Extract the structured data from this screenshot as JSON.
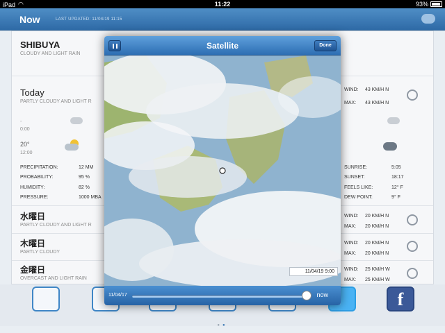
{
  "statusbar": {
    "device": "iPad",
    "time": "11:22",
    "battery": "93%"
  },
  "header": {
    "title": "Now",
    "updated": "LAST UPDATED: 11/04/19 11:15"
  },
  "location": {
    "name": "SHIBUYA",
    "condition": "CLOUDY AND LIGHT RAIN"
  },
  "today": {
    "title": "Today",
    "condition": "PARTLY CLOUDY AND LIGHT R",
    "left_temp_a": "-",
    "left_temp_b": "0:00",
    "left_temp_c": "20°",
    "left_time": "12:00",
    "rows_left": [
      {
        "label": "PRECIPITATION:",
        "value": "12 MM"
      },
      {
        "label": "PROBABILITY:",
        "value": "95 %"
      },
      {
        "label": "HUMIDITY:",
        "value": "82 %"
      },
      {
        "label": "PRESSURE:",
        "value": "1000 MBA"
      }
    ],
    "rows_right": [
      {
        "label": "SUNRISE:",
        "value": "5:05"
      },
      {
        "label": "SUNSET:",
        "value": "18:17"
      },
      {
        "label": "FEELS LIKE:",
        "value": "12° F"
      },
      {
        "label": "DEW POINT:",
        "value": "9° F"
      }
    ],
    "wind": {
      "label": "WIND:",
      "value": "43 KM/H N"
    },
    "max": {
      "label": "MAX:",
      "value": "43 KM/H N"
    }
  },
  "days": [
    {
      "name": "水曜日",
      "condition": "PARTLY CLOUDY AND LIGHT R",
      "wind": "20 KM/H N",
      "max": "20 KM/H N"
    },
    {
      "name": "木曜日",
      "condition": "PARTLY CLOUDY",
      "wind": "20 KM/H N",
      "max": "20 KM/H N"
    },
    {
      "name": "金曜日",
      "condition": "OVERCAST AND LIGHT RAIN",
      "wind": "25 KM/H W",
      "max": "25 KM/H W"
    }
  ],
  "labels": {
    "wind": "WIND:",
    "max": "MAX:"
  },
  "modal": {
    "title": "Satellite",
    "done": "Done",
    "timestamp": "11/04/19 9:00",
    "start": "11/04/17",
    "end": "now",
    "progress": 0.98
  },
  "colors": {
    "accent": "#2e6aa6",
    "cloud": "#f2f4f6",
    "land": "#9db46f",
    "sea": "#8fb3cf"
  }
}
